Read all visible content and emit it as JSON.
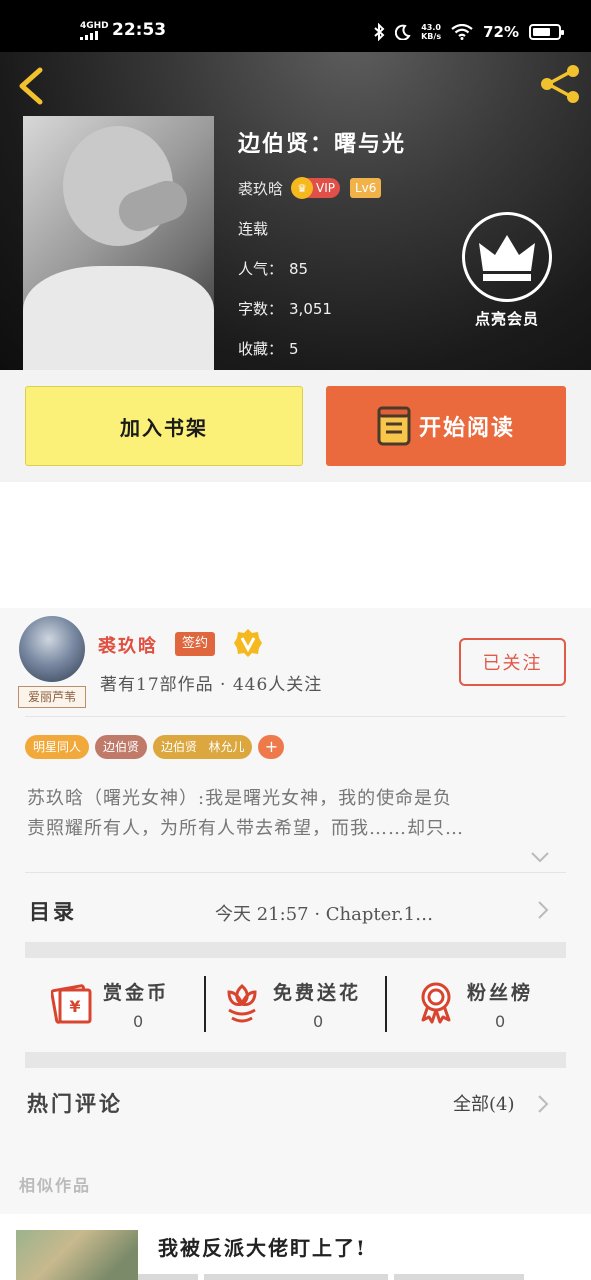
{
  "status_bar": {
    "network": "4GHD",
    "time": "22:53",
    "speed": "43.0",
    "speed_unit": "KB/s",
    "battery": "72%",
    "battery_level": 0.72
  },
  "book": {
    "title": "边伯贤：曙与光",
    "author": "裘玖晗",
    "vip_label": "VIP",
    "level": "Lv6",
    "status": "连载",
    "popularity_label": "人气：",
    "popularity": "85",
    "words_label": "字数：",
    "words": "3,051",
    "favorites_label": "收藏：",
    "favorites": "5",
    "member_label": "点亮会员"
  },
  "actions": {
    "add_shelf": "加入书架",
    "start_reading": "开始阅读"
  },
  "author_card": {
    "avatar_tag": "爱丽芦苇",
    "name": "裘玖晗",
    "signed": "签约",
    "stats": "著有17部作品 · 446人关注",
    "follow_label": "已关注",
    "tags": [
      {
        "label": "明星同人",
        "color": "#f2a93b"
      },
      {
        "label": "边伯贤",
        "color": "#c07a6a"
      },
      {
        "label": "边伯贤   林允儿",
        "color": "#dba73e"
      }
    ],
    "tag_add": "+",
    "intro_line1": "苏玖晗（曙光女神）:我是曙光女神，我的使命是负",
    "intro_line2": "责照耀所有人，为所有人带去希望，而我……却只…"
  },
  "toc": {
    "label": "目录",
    "latest": "今天  21:57  ·  Chapter.1…"
  },
  "gifts": [
    {
      "label": "赏金币",
      "value": "0"
    },
    {
      "label": "免费送花",
      "value": "0"
    },
    {
      "label": "粉丝榜",
      "value": "0"
    }
  ],
  "comments": {
    "label": "热门评论",
    "all_label": "全部(4)"
  },
  "similar": {
    "label": "相似作品",
    "first_title": "我被反派大佬盯上了!"
  },
  "colors": {
    "accent_orange": "#ea6a3e",
    "shelf_yellow": "#fbf179",
    "author_red": "#e05040",
    "icon_red": "#d9442e"
  }
}
